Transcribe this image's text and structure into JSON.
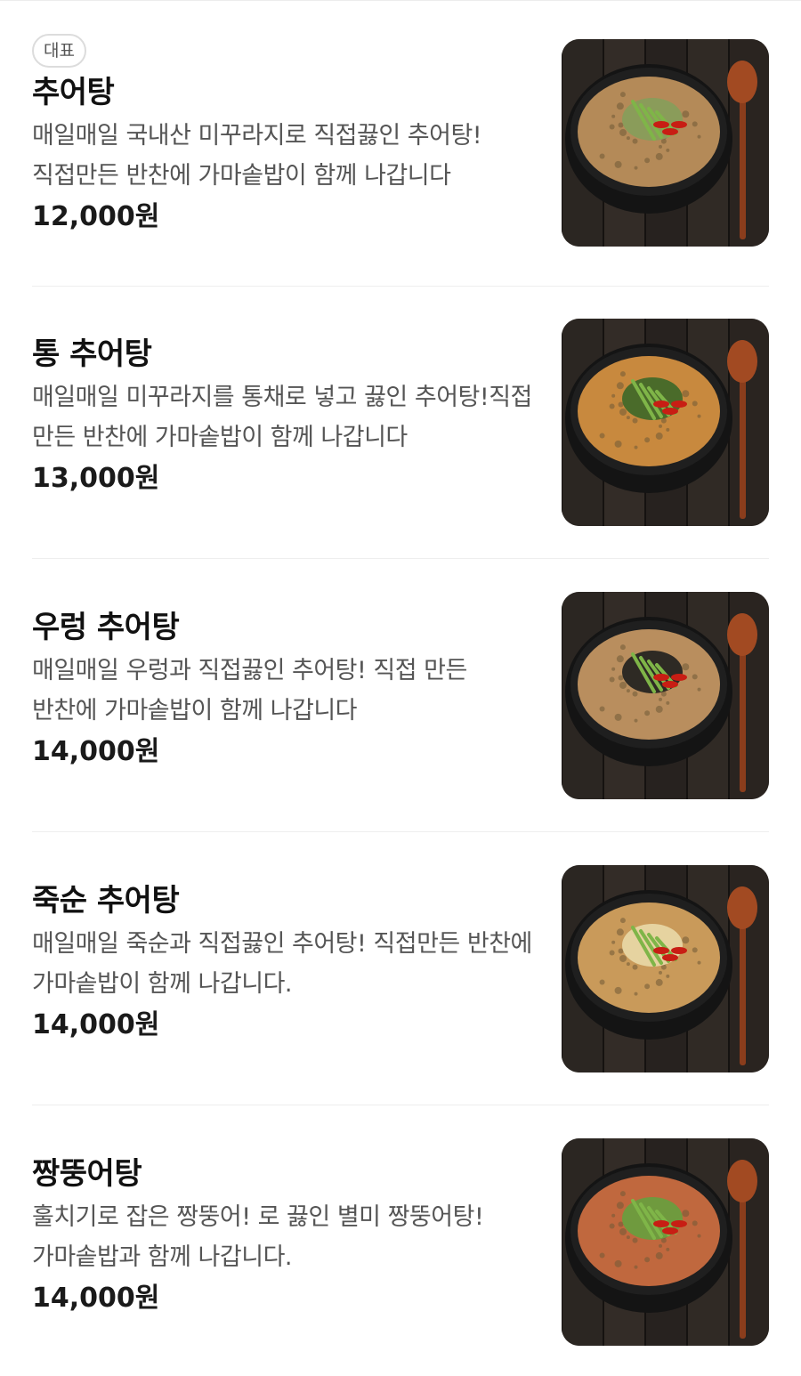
{
  "currency_suffix": "원",
  "items": [
    {
      "badge": "대표",
      "name": "추어탕",
      "description": "매일매일 국내산 미꾸라지로 직접끓인 추어탕! 직접만든 반찬에 가마솥밥이 함께 나갑니다",
      "price": "12,000원",
      "dish": "chueotang",
      "broth_color": "#b48a58",
      "topping_color": "#8a9c5a"
    },
    {
      "name": "통 추어탕",
      "description": "매일매일 미꾸라지를 통채로 넣고 끓인 추어탕!직접 만든 반찬에 가마솥밥이 함께 나갑니다",
      "price": "13,000원",
      "dish": "whole-loach-chueotang",
      "broth_color": "#c8893e",
      "topping_color": "#4a6b2a"
    },
    {
      "name": "우렁 추어탕",
      "description": "매일매일 우렁과 직접끓인 추어탕! 직접 만든 반찬에 가마솥밥이 함께 나갑니다",
      "price": "14,000원",
      "dish": "snail-chueotang",
      "broth_color": "#b98e5e",
      "topping_color": "#2e2a24"
    },
    {
      "name": "죽순 추어탕",
      "description": "매일매일 죽순과 직접끓인 추어탕! 직접만든 반찬에 가마솥밥이 함께 나갑니다.",
      "price": "14,000원",
      "dish": "bamboo-shoot-chueotang",
      "broth_color": "#c99a5a",
      "topping_color": "#e6d3a0"
    },
    {
      "name": "짱뚱어탕",
      "description": "훌치기로 잡은 짱뚱어! 로 끓인 별미 짱뚱어탕! 가마솥밥과 함께 나갑니다.",
      "price": "14,000원",
      "dish": "mudskipper-soup",
      "broth_color": "#c0683e",
      "topping_color": "#6f9a3e"
    }
  ]
}
